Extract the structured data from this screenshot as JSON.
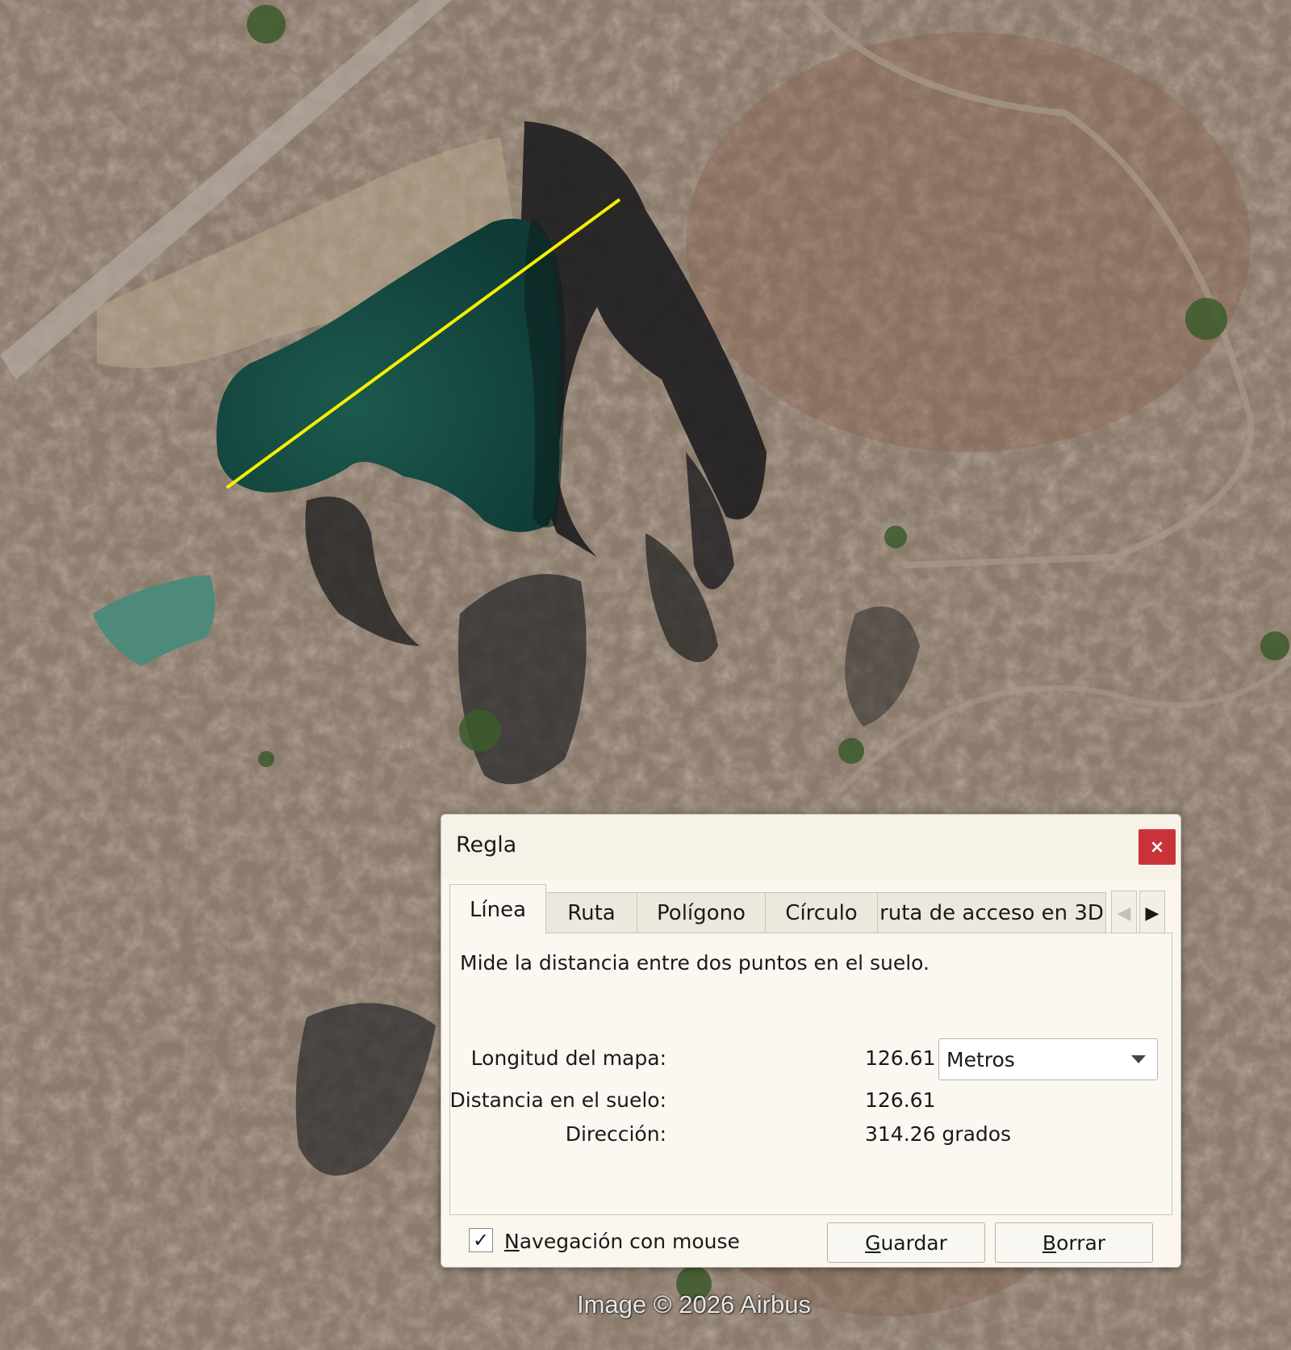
{
  "map": {
    "attribution": "Image © 2026 Airbus",
    "measure_line_color": "#f4f000",
    "water_color": "#1f5a4c"
  },
  "dialog": {
    "title": "Regla",
    "close_label": "×",
    "tabs": [
      {
        "label": "Línea",
        "active": true
      },
      {
        "label": "Ruta",
        "active": false
      },
      {
        "label": "Polígono",
        "active": false
      },
      {
        "label": "Círculo",
        "active": false
      },
      {
        "label": "ruta de acceso en 3D",
        "active": false
      }
    ],
    "description": "Mide la distancia entre dos puntos en el suelo.",
    "map_length_label": "Longitud del mapa:",
    "map_length_value": "126.61",
    "unit": "Metros",
    "ground_distance_label": "Distancia en el suelo:",
    "ground_distance_value": "126.61",
    "heading_label": "Dirección:",
    "heading_value": "314.26 grados",
    "mouse_nav_checked": true,
    "mouse_nav_label_first": "N",
    "mouse_nav_label_rest": "avegación con mouse",
    "save_first": "G",
    "save_rest": "uardar",
    "clear_first": "B",
    "clear_rest": "orrar"
  }
}
